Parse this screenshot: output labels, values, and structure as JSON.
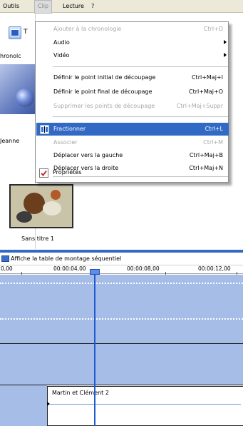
{
  "menubar": {
    "items": [
      {
        "label": "Outils"
      },
      {
        "label": "Clip"
      },
      {
        "label": "Lecture"
      },
      {
        "label": "?"
      }
    ]
  },
  "background": {
    "task_button_fragment": "T",
    "chrono_fragment": "hronolc",
    "collection_label_fragment": "Jeanne",
    "clip_label": "Sans titre 1"
  },
  "timeline": {
    "header": "Affiche la table de montage séquentiel",
    "ruler": [
      "0,00",
      "00:00:04,00",
      "00:00:08,00",
      "00:00:12,00"
    ],
    "audio_clip": "Martin et Clément 2",
    "colors": {
      "track": "#a6bde8",
      "playhead": "#1f5bd0"
    }
  },
  "menu": {
    "items": [
      {
        "label": "Ajouter à la chronologie",
        "shortcut": "Ctrl+D",
        "disabled": true
      },
      {
        "label": "Audio",
        "submenu": true
      },
      {
        "label": "Vidéo",
        "submenu": true
      },
      {
        "label": "Définir le point initial de découpage",
        "shortcut": "Ctrl+Maj+I"
      },
      {
        "label": "Définir le point final de découpage",
        "shortcut": "Ctrl+Maj+O"
      },
      {
        "label": "Supprimer les points de découpage",
        "shortcut": "Ctrl+Maj+Suppr",
        "disabled": true
      },
      {
        "label": "Fractionner",
        "shortcut": "Ctrl+L",
        "highlighted": true
      },
      {
        "label": "Associer",
        "shortcut": "Ctrl+M",
        "disabled": true
      },
      {
        "label": "Déplacer vers la gauche",
        "shortcut": "Ctrl+Maj+B"
      },
      {
        "label": "Déplacer vers la droite",
        "shortcut": "Ctrl+Maj+N"
      },
      {
        "label": "Propriétés"
      }
    ],
    "colors": {
      "highlight": "#316ac5",
      "disabled_text": "#a8a8a8"
    }
  }
}
